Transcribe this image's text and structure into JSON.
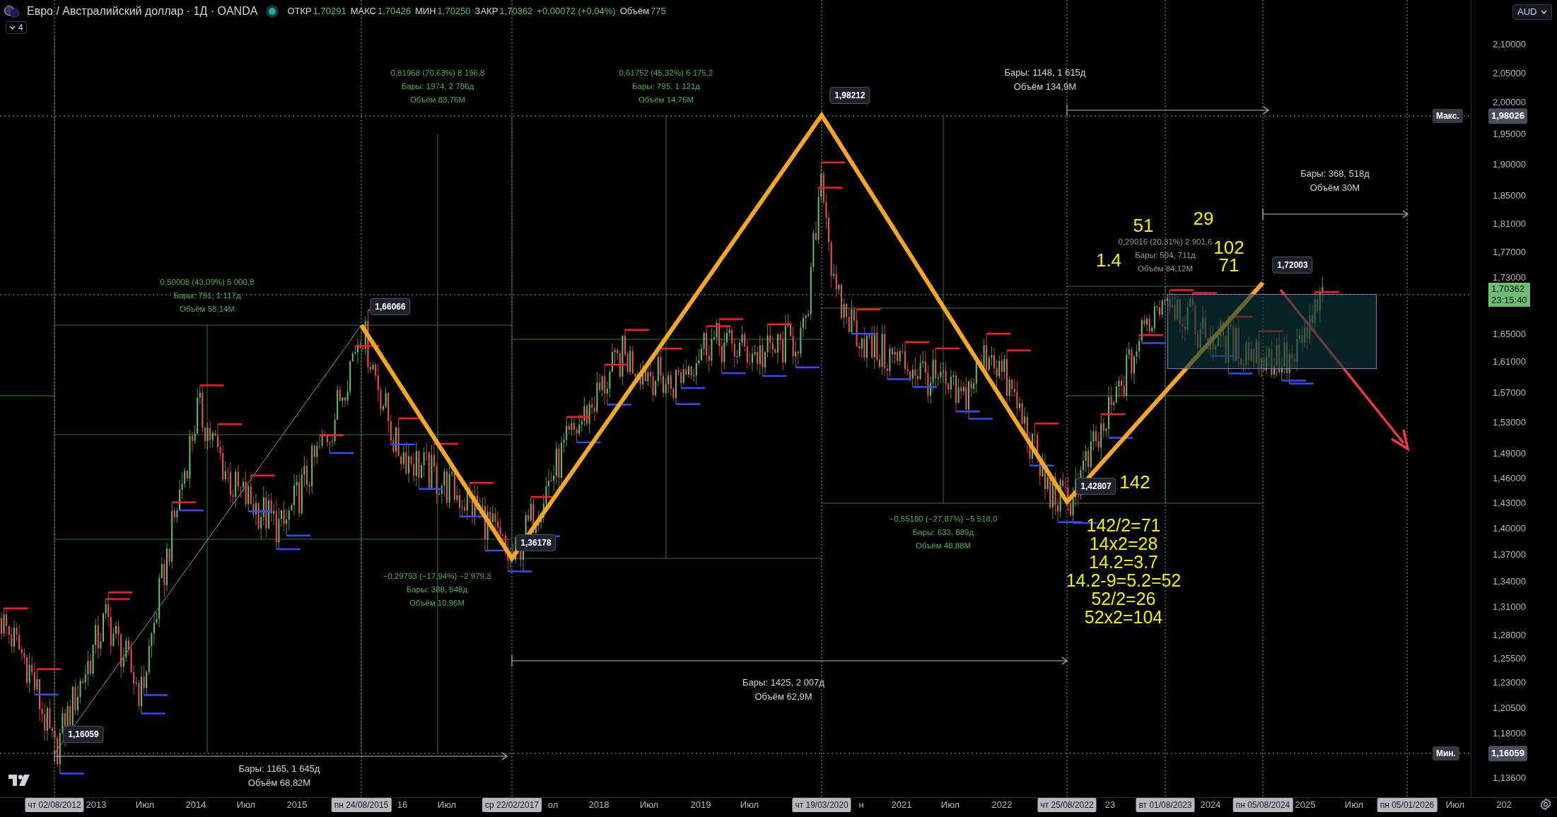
{
  "header": {
    "symbol": "Евро / Австралийский доллар · 1Д · OANDA",
    "ohlc": [
      {
        "label": "ОТКР",
        "value": "1,70291"
      },
      {
        "label": "МАКС",
        "value": "1,70426"
      },
      {
        "label": "МИН",
        "value": "1,70250"
      },
      {
        "label": "ЗАКР",
        "value": "1,70362"
      }
    ],
    "change": "+0,00072 (+0,04%)",
    "volume_label": "Объём",
    "volume": "775",
    "indicator_count": "4"
  },
  "currency": "AUD",
  "price_scale": {
    "ticks": [
      "2,10000",
      "2,05000",
      "2,00000",
      "1,95000",
      "1,90000",
      "1,85000",
      "1,81000",
      "1,77000",
      "1,73000",
      "1,65000",
      "1,61000",
      "1,57000",
      "1,53000",
      "1,49000",
      "1,46000",
      "1,43000",
      "1,40000",
      "1,37000",
      "1,34000",
      "1,31000",
      "1,28000",
      "1,25500",
      "1,23000",
      "1,20500",
      "1,18000",
      "1,13600"
    ],
    "max": {
      "tag": "Макс.",
      "value": "1,98026"
    },
    "last": {
      "value": "1,70362",
      "countdown": "23:15:40"
    },
    "min": {
      "tag": "Мин.",
      "value": "1,16059"
    }
  },
  "time_axis": {
    "labels": [
      "2013",
      "Июл",
      "2014",
      "Июл",
      "2015",
      "16",
      "Июл",
      "ол",
      "2018",
      "Июл",
      "2019",
      "Июл",
      "н",
      "2021",
      "Июл",
      "2022",
      "23",
      "2024",
      "2025",
      "Июл",
      "Июл",
      "202"
    ],
    "highlighted": [
      "чт 02/08/2012",
      "пн 24/08/2015",
      "ср 22/02/2017",
      "чт 19/03/2020",
      "чт 25/08/2022",
      "вт 01/08/2023",
      "пн 05/08/2024",
      "пн 05/01/2026"
    ]
  },
  "pivots": [
    "1,16059",
    "1,66066",
    "1,36178",
    "1,98212",
    "1,42807",
    "1,72003"
  ],
  "measurements": [
    {
      "change": "0,50008 (43,09%) 5 000,8",
      "bars": "Бары: 791, 1 117д",
      "volume": "Объём 58,14M",
      "color": "#4caf50"
    },
    {
      "change": "0,81968 (70,63%) 8 196,8",
      "bars": "Бары: 1974, 2 786д",
      "volume": "Объём 83,76M",
      "color": "#4caf50"
    },
    {
      "change": "0,61752 (45,32%) 6 175,2",
      "bars": "Бары: 795, 1 121д",
      "volume": "Объём 14,76M",
      "color": "#4caf50"
    },
    {
      "change": "−0,29793 (−17,94%) −2 979,3",
      "bars": "Бары: 388, 548д",
      "volume": "Объём 10,96M",
      "color": "#4caf50"
    },
    {
      "change": "−0,55180 (−27,87%) −5 518,0",
      "bars": "Бары: 633, 889д",
      "volume": "Объём 48,88M",
      "color": "#4caf50"
    },
    {
      "change": "0,29016 (20,31%) 2 901,6",
      "bars": "Бары: 504, 711д",
      "volume": "Объём 84,12M",
      "color": "#9598a1"
    }
  ],
  "date_ranges": [
    {
      "bars": "Бары: 1148, 1 615д",
      "volume": "Объём 134,9M"
    },
    {
      "bars": "Бары: 368, 518д",
      "volume": "Объём 30M"
    },
    {
      "bars": "Бары: 1425, 2 007д",
      "volume": "Объём 62,9M"
    },
    {
      "bars": "Бары: 1165, 1 645д",
      "volume": "Объём 68,82M"
    }
  ],
  "notes": [
    "51",
    "29",
    "1.4",
    "102",
    "71",
    "142"
  ],
  "calculation": [
    "142/2=71",
    "14x2=28",
    "14.2=3.7",
    "14.2-9=5.2=52",
    "52/2=26",
    "52x2=104"
  ]
}
